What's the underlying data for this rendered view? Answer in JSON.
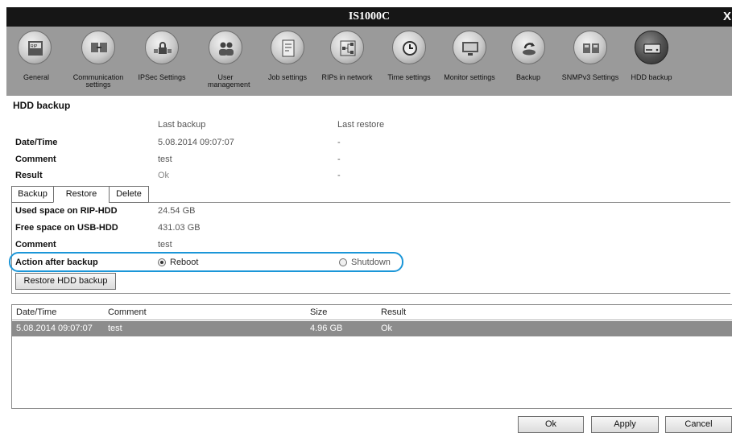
{
  "window": {
    "title": "IS1000C",
    "close_glyph": "X"
  },
  "toolbar": [
    {
      "label": "General",
      "icon": "rip-device-icon"
    },
    {
      "label": "Communication settings",
      "icon": "network-computers-icon"
    },
    {
      "label": "IPSec Settings",
      "icon": "lock-network-icon"
    },
    {
      "label": "User management",
      "icon": "users-icon"
    },
    {
      "label": "Job settings",
      "icon": "job-document-icon"
    },
    {
      "label": "RIPs in network",
      "icon": "network-tree-icon"
    },
    {
      "label": "Time settings",
      "icon": "clock-icon"
    },
    {
      "label": "Monitor settings",
      "icon": "monitor-icon"
    },
    {
      "label": "Backup",
      "icon": "backup-disk-icon"
    },
    {
      "label": "SNMPv3 Settings",
      "icon": "snmp-computers-icon"
    },
    {
      "label": "HDD backup",
      "icon": "hard-drive-icon",
      "active": true
    }
  ],
  "section_title": "HDD backup",
  "summary": {
    "col_last_backup": "Last backup",
    "col_last_restore": "Last restore",
    "rows": [
      {
        "label": "Date/Time",
        "backup": "5.08.2014 09:07:07",
        "restore": "-"
      },
      {
        "label": "Comment",
        "backup": "test",
        "restore": "-"
      },
      {
        "label": "Result",
        "backup": "Ok",
        "restore": "-"
      }
    ]
  },
  "tabs": [
    {
      "label": "Backup"
    },
    {
      "label": "Restore",
      "active": true
    },
    {
      "label": "Delete"
    }
  ],
  "restore_panel": {
    "used_label": "Used space on RIP-HDD",
    "used_value": "24.54 GB",
    "free_label": "Free space on USB-HDD",
    "free_value": "431.03 GB",
    "comment_label": "Comment",
    "comment_value": "test",
    "action_label": "Action after backup",
    "option_reboot": "Reboot",
    "option_shutdown": "Shutdown",
    "selected_option": "Reboot",
    "restore_button": "Restore HDD backup"
  },
  "backups_table": {
    "columns": [
      "Date/Time",
      "Comment",
      "Size",
      "Result"
    ],
    "rows": [
      [
        "5.08.2014 09:07:07",
        "test",
        "4.96 GB",
        "Ok"
      ]
    ]
  },
  "footer": {
    "ok": "Ok",
    "apply": "Apply",
    "cancel": "Cancel"
  },
  "colors": {
    "highlight": "#1b96d8",
    "toolbar_bg": "#9a9a9a",
    "titlebar_bg": "#161616",
    "selected_row": "#8c8c8c"
  }
}
